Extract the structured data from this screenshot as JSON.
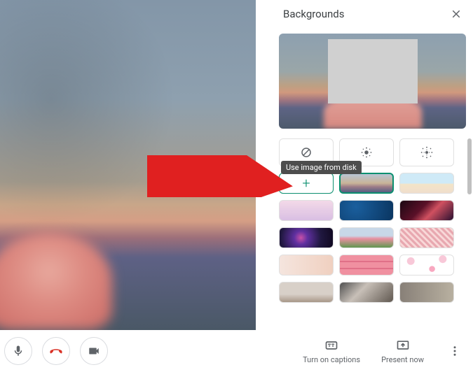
{
  "panel": {
    "title": "Backgrounds",
    "upload_tooltip": "Use image from disk",
    "effect_rows": [
      {
        "items": [
          {
            "name": "no-effect"
          },
          {
            "name": "blur-light"
          },
          {
            "name": "blur-heavy"
          }
        ]
      }
    ],
    "bg_rows": [
      {
        "items": [
          {
            "name": "upload",
            "kind": "upload"
          },
          {
            "name": "sunset",
            "cls": "bg-sunset",
            "selected": true
          },
          {
            "name": "beach",
            "cls": "bg-beach"
          }
        ]
      },
      {
        "items": [
          {
            "name": "pink-clouds",
            "cls": "bg-pinkcloud"
          },
          {
            "name": "ocean-water",
            "cls": "bg-water"
          },
          {
            "name": "nebula",
            "cls": "bg-nebula"
          }
        ]
      },
      {
        "items": [
          {
            "name": "fireworks",
            "cls": "bg-fireworks"
          },
          {
            "name": "spring-flowers",
            "cls": "bg-flowers1"
          },
          {
            "name": "cherry-blossom",
            "cls": "bg-flowers2"
          }
        ]
      },
      {
        "items": [
          {
            "name": "soft-pastel",
            "cls": "bg-soft"
          },
          {
            "name": "pink-pattern",
            "cls": "bg-pattern"
          },
          {
            "name": "petals",
            "cls": "bg-petals"
          }
        ]
      },
      {
        "items": [
          {
            "name": "room-gallery",
            "cls": "bg-room1"
          },
          {
            "name": "room-light",
            "cls": "bg-room2"
          },
          {
            "name": "room-office",
            "cls": "bg-room3"
          }
        ]
      }
    ]
  },
  "bottombar": {
    "captions_label": "Turn on captions",
    "present_label": "Present now"
  }
}
